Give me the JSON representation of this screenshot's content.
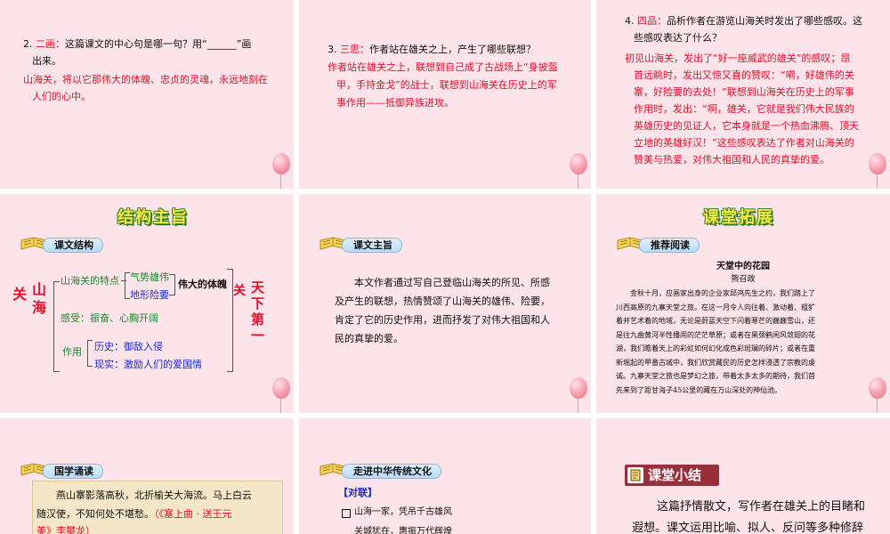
{
  "slide1": {
    "q_number": "2.",
    "q_tag": "二画：",
    "q_text": "这篇课文的中心句是哪一句？用“______”画",
    "q_text2": "出来。",
    "answer1": "山海关，将以它那伟大的体魄、忠贞的灵魂，永远地刻在",
    "answer2": "人们的心中。"
  },
  "slide2": {
    "q_number": "3.",
    "q_tag": "三思：",
    "q_text": "作者站在雄关之上，产生了哪些联想？",
    "answer1": "作者站在雄关之上，联想到自己成了古战场上“身披盔",
    "answer2": "甲，手持金戈”的战士，联想到山海关在历史上的军",
    "answer3": "事作用——抵御异族进攻。"
  },
  "slide3": {
    "q_number": "4.",
    "q_tag": "四品：",
    "q_text": "品析作者在游览山海关时发出了哪些感叹。这",
    "q_text2": "些感叹表达了什么？",
    "answer_lines": [
      "初见山海关，发出了“好一座威武的雄关”的感叹；昂",
      "首远眺时，发出又惊又喜的赞叹：“嗬，好雄伟的关",
      "寨，好险要的去处！”联想到山海关在历史上的军事",
      "作用时，发出：“啊，雄关，它就是我们伟大民族的",
      "英雄历史的见证人，它本身就是一个热血沸腾、顶天",
      "立地的英雄好汉！”这些感叹表达了作者对山海关的",
      "赞美与热爱，对伟大祖国和人民的真挚的爱。"
    ]
  },
  "slide4": {
    "title": "结构主旨",
    "tag": "课文结构",
    "left_label": "关 山 海",
    "left_chars": [
      "关",
      "山",
      "海"
    ],
    "branch1": "山海关的特点",
    "branch1_sub1": "气势雄伟",
    "branch1_sub2": "地形险要",
    "great_body": "伟大的体魄",
    "right_chars1": [
      "关"
    ],
    "right_chars2": [
      "天",
      "下",
      "第",
      "一"
    ],
    "branch2_label": "感受：",
    "branch2_value": "振奋、心胸开阔",
    "branch3": "作用",
    "branch3_sub1_label": "历史：",
    "branch3_sub1_value": "御敌入侵",
    "branch3_sub2_label": "现实：",
    "branch3_sub2_value": "激励人们的爱国情"
  },
  "slide5": {
    "tag": "课文主旨",
    "lines": [
      "本文作者通过写自己登临山海关的所见、所感",
      "及产生的联想，热情赞颂了山海关的雄伟、险要，",
      "肯定了它的历史作用，进而抒发了对伟大祖国和人",
      "民的真挚的爱。"
    ]
  },
  "slide6": {
    "title": "课堂拓展",
    "tag": "推荐阅读",
    "article_title": "天堂中的花园",
    "author": "熊召政",
    "lines": [
      "金秋十月，应画家出身的企业家邱鸿先生之约，我们踏上了",
      "川西高原的九寨天堂之旅。在这一月令人向往着、激动着、粗犷",
      "着并艺术着的地域，无论是蔚蓝天空下闪着寒芒的巍巍雪山，还",
      "是往九曲黄河半性播闹的茫茫草原；或者在黑颈鹤闲风敛翅的花",
      "湖，我们瞻着天上的彩虹如何幻化成色彩斑斓的碎片；或者在重",
      "新堀起的甲番古城中，我们欣赏藏民的历史怎样浸透了宗教的虔",
      "诚。九寨天堂之旅也是梦幻之旅，带着太多太多的期待，我们首",
      "先来到了距甘海子45公里的藏在万山深处的神仙池。"
    ]
  },
  "slide7": {
    "tag": "国学诵读",
    "line1": "燕山寨影落高秋，北折榆关大海流。马上白云",
    "line2_black": "随汉使，不知何处不堪愁。",
    "line2_red": "（《塞上曲 · 送王元",
    "line3_red": "美》李攀龙）"
  },
  "slide8": {
    "tag": "走进中华传统文化",
    "heading": "【对联】",
    "line1": "山海一家，凭吊千古雄风",
    "line2": "关城犹在，惠振万代辉煌"
  },
  "slide9": {
    "badge": "课堂小结",
    "line1": "这篇抒情散文，写作者在雄关上的目睹和",
    "line2": "遐想。课文运用比喻、拟人、反问等多种修辞"
  }
}
